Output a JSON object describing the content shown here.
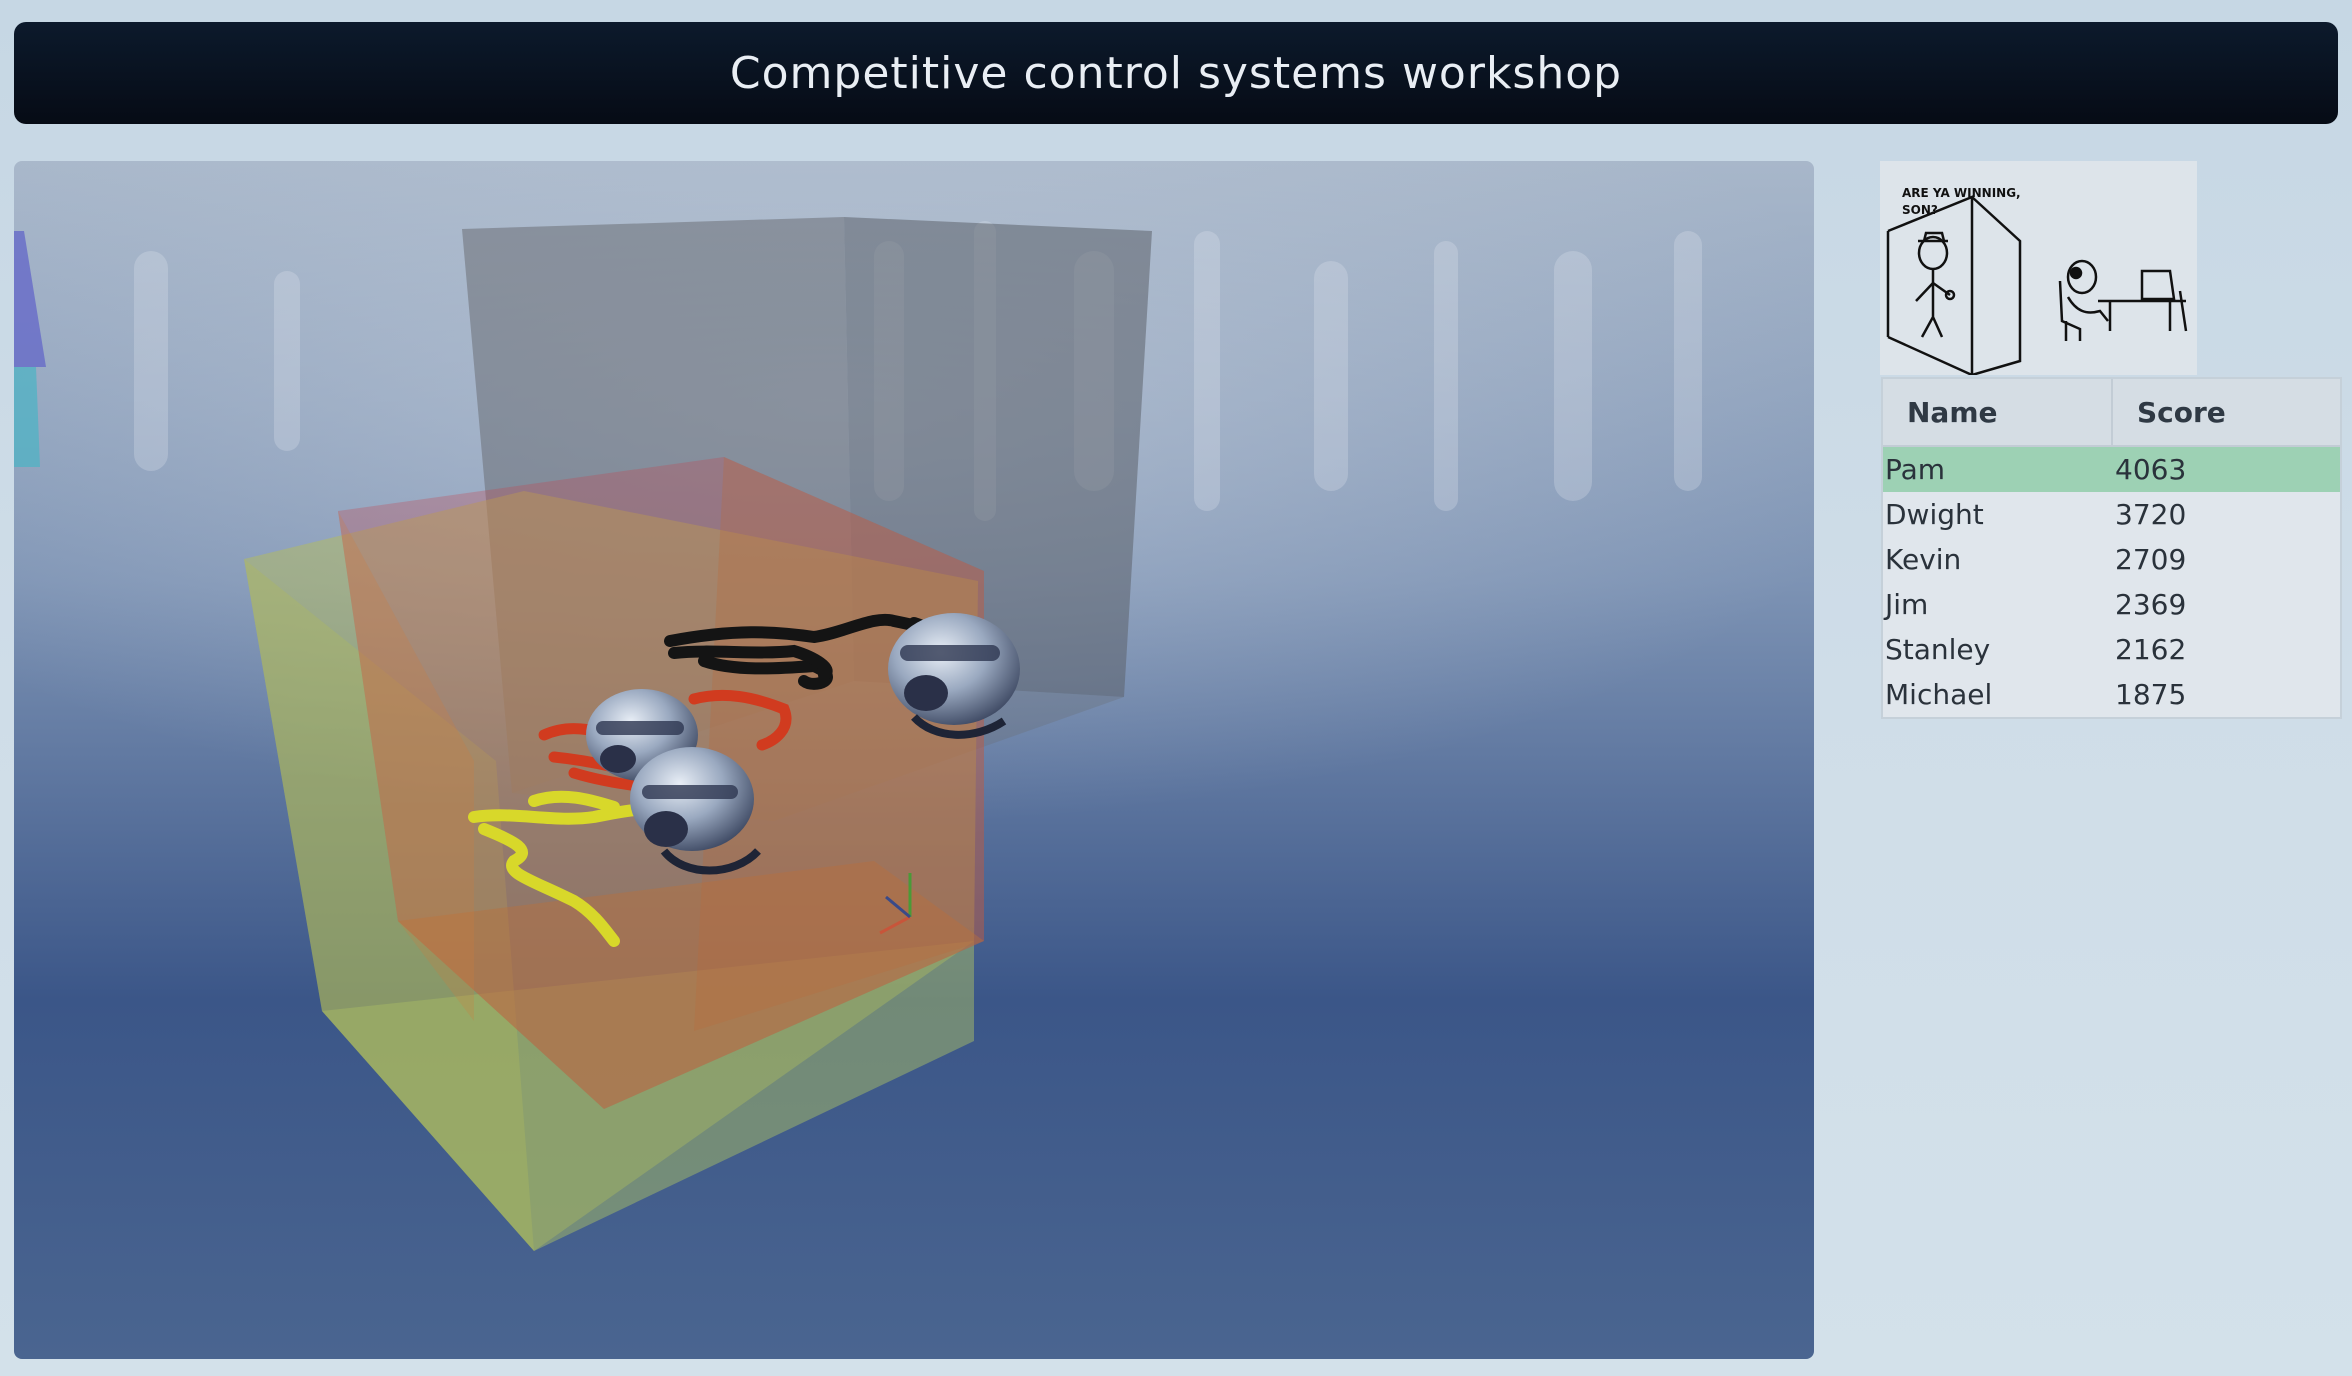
{
  "header": {
    "title": "Competitive control systems workshop"
  },
  "meme": {
    "caption_line1": "ARE YA WINNING,",
    "caption_line2": "SON?"
  },
  "leaderboard": {
    "columns": [
      "Name",
      "Score"
    ],
    "rows": [
      {
        "name": "Pam",
        "score": "4063"
      },
      {
        "name": "Dwight",
        "score": "3720"
      },
      {
        "name": "Kevin",
        "score": "2709"
      },
      {
        "name": "Jim",
        "score": "2369"
      },
      {
        "name": "Stanley",
        "score": "2162"
      },
      {
        "name": "Michael",
        "score": "1875"
      }
    ],
    "highlight_row": 0,
    "highlight_color": "#9dd1b4"
  },
  "scene": {
    "sky_top": "#9fb0c6",
    "sky_bottom": "#2e4a7e",
    "trail_colors": [
      "#111111",
      "#d33a1c",
      "#d8d82a"
    ],
    "box_colors": [
      "#6a6a6a",
      "#c8404a",
      "#c9c438"
    ]
  }
}
